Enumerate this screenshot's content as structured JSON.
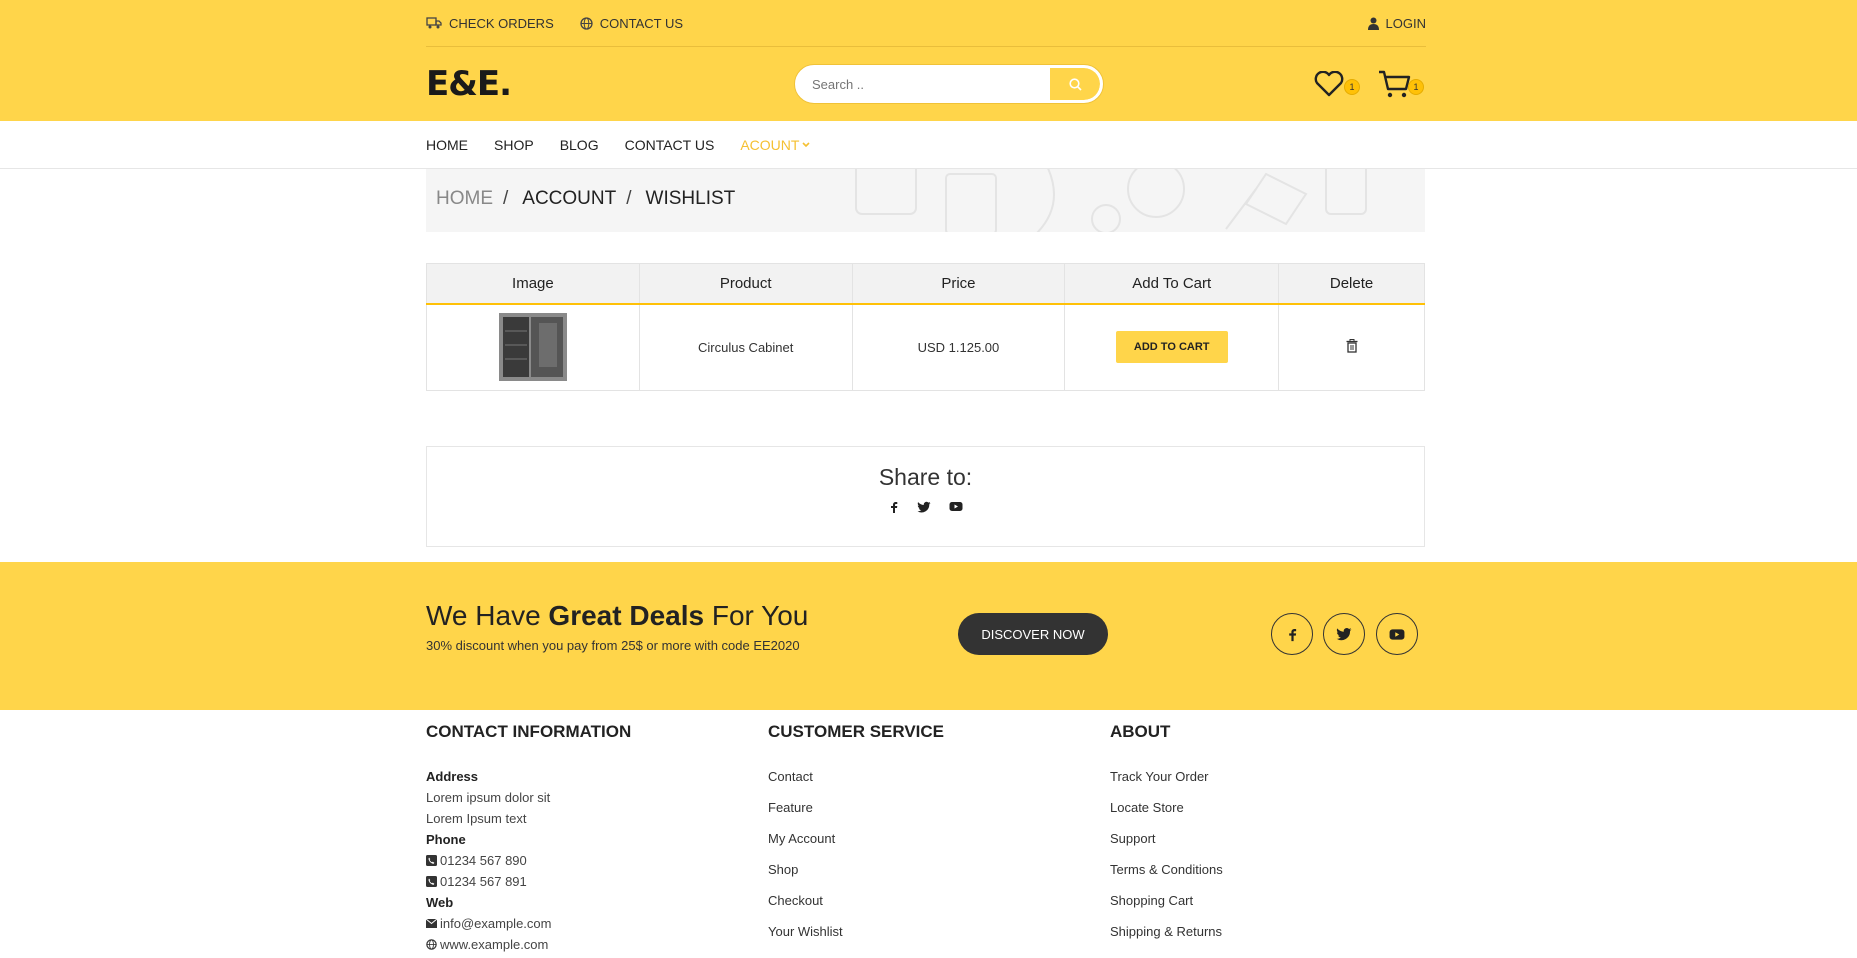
{
  "topbar": {
    "check_orders": "CHECK ORDERS",
    "contact_us": "CONTACT US",
    "login": "LOGIN"
  },
  "header": {
    "logo": "E&E.",
    "search_placeholder": "Search ..",
    "wishlist_count": "1",
    "cart_count": "1"
  },
  "nav": {
    "items": [
      "HOME",
      "SHOP",
      "BLOG",
      "CONTACT US"
    ],
    "active": "ACOUNT"
  },
  "breadcrumb": {
    "home": "HOME",
    "account": "ACCOUNT",
    "current": "WISHLIST",
    "sep": "/"
  },
  "table": {
    "headers": [
      "Image",
      "Product",
      "Price",
      "Add To Cart",
      "Delete"
    ],
    "rows": [
      {
        "product": "Circulus Cabinet",
        "price": "USD 1.125.00",
        "button": "ADD TO CART"
      }
    ]
  },
  "share": {
    "title": "Share to:"
  },
  "deals": {
    "title_pre": "We Have ",
    "title_bold": "Great Deals",
    "title_post": " For You",
    "subtitle": "30% discount when you pay from 25$ or more with code EE2020",
    "button": "DISCOVER NOW"
  },
  "footer": {
    "contact": {
      "heading": "CONTACT INFORMATION",
      "address_label": "Address",
      "address_1": "Lorem ipsum dolor sit",
      "address_2": "Lorem Ipsum text",
      "phone_label": "Phone",
      "phone_1": "01234 567 890",
      "phone_2": "01234 567 891",
      "web_label": "Web",
      "email": "info@example.com",
      "site": "www.example.com"
    },
    "service": {
      "heading": "CUSTOMER SERVICE",
      "links": [
        "Contact",
        "Feature",
        "My Account",
        "Shop",
        "Checkout",
        "Your Wishlist"
      ]
    },
    "about": {
      "heading": "ABOUT",
      "links": [
        "Track Your Order",
        "Locate Store",
        "Support",
        "Terms & Conditions",
        "Shopping Cart",
        "Shipping & Returns"
      ]
    }
  },
  "colors": {
    "accent": "#ffd54a",
    "dark": "#333333"
  }
}
